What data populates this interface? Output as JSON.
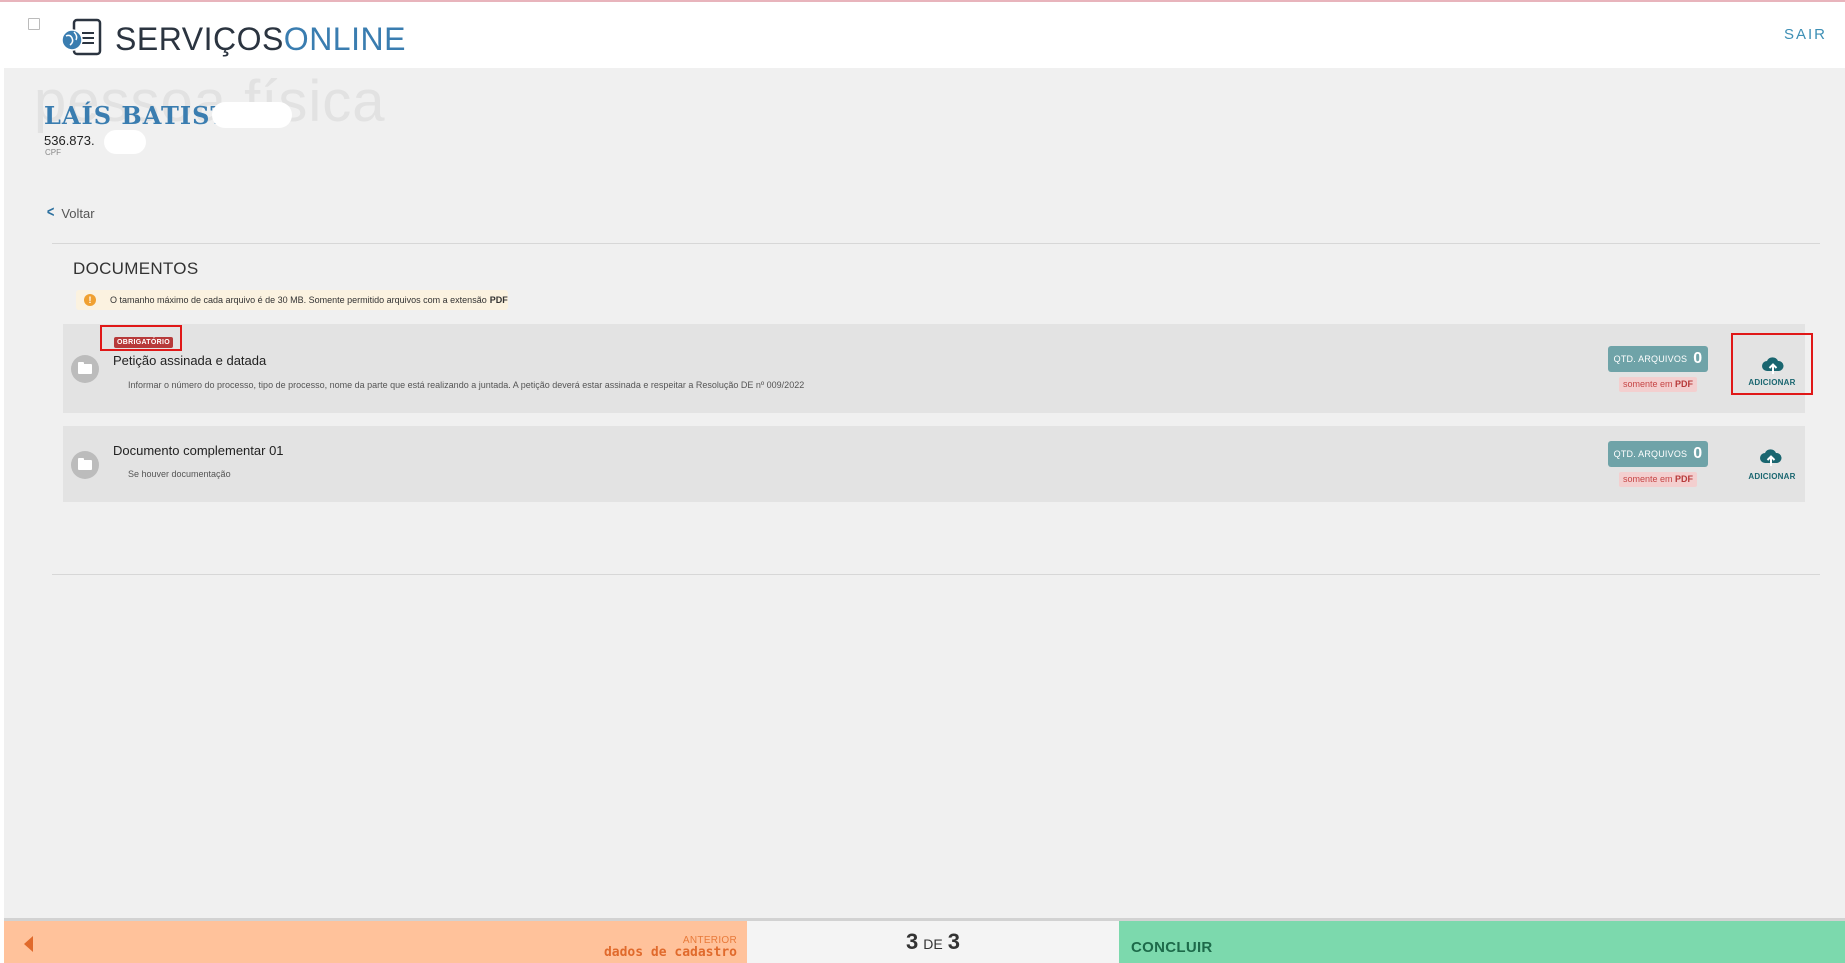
{
  "header": {
    "brand_part1": "SERVIÇOS",
    "brand_part2": "ONLINE",
    "logout_label": "SAIR"
  },
  "profile": {
    "watermark": "pessoa física",
    "name": "LAÍS BATISTA",
    "cpf": "536.873.",
    "cpf_label": "CPF"
  },
  "nav": {
    "back_label": "Voltar"
  },
  "documents": {
    "title": "DOCUMENTOS",
    "info_text": "O tamanho máximo de cada arquivo é de 30 MB. Somente permitido arquivos com a extensão",
    "info_ext": "PDF",
    "items": [
      {
        "badge": "OBRIGATÓRIO",
        "name": "Petição assinada e datada",
        "description": "Informar o número do processo, tipo de processo, nome da parte que está realizando a juntada. A petição deverá estar assinada e respeitar a Resolução DE nº 009/2022",
        "qty_label": "QTD. ARQUIVOS",
        "qty_value": "0",
        "pdf_note": "somente em",
        "pdf_ext": "PDF",
        "add_label": "ADICIONAR"
      },
      {
        "name": "Documento complementar 01",
        "description": "Se houver documentação",
        "qty_label": "QTD. ARQUIVOS",
        "qty_value": "0",
        "pdf_note": "somente em",
        "pdf_ext": "PDF",
        "add_label": "ADICIONAR"
      }
    ]
  },
  "footer": {
    "prev_label": "ANTERIOR",
    "prev_sub": "dados de cadastro",
    "step_current": "3",
    "step_sep": "DE",
    "step_total": "3",
    "next_label": "CONCLUIR"
  },
  "colors": {
    "brand_blue": "#3a7db0",
    "prev_bg": "#ffc29b",
    "next_bg": "#7cd9ad",
    "required_red": "#b73a3a",
    "qty_teal": "#6fa3a8"
  }
}
